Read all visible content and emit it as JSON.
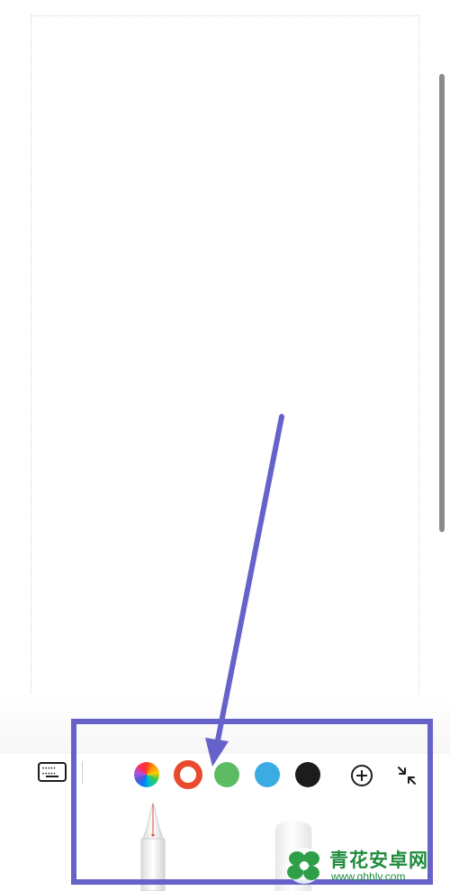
{
  "toolbar": {
    "keyboard_icon": "keyboard-icon",
    "colors": [
      {
        "name": "color-picker",
        "value": "rainbow"
      },
      {
        "name": "red",
        "value": "#e84a2e",
        "selected": true
      },
      {
        "name": "green",
        "value": "#5dbb63"
      },
      {
        "name": "blue",
        "value": "#3aabe3"
      },
      {
        "name": "black",
        "value": "#1c1c1c"
      }
    ],
    "add_icon": "plus-circle-icon",
    "collapse_icon": "collapse-icon",
    "tools": [
      "fountain-pen",
      "eraser"
    ]
  },
  "annotation": {
    "color": "#6563c9"
  },
  "watermark": {
    "title": "青花安卓网",
    "url": "www.qhhlv.com"
  }
}
